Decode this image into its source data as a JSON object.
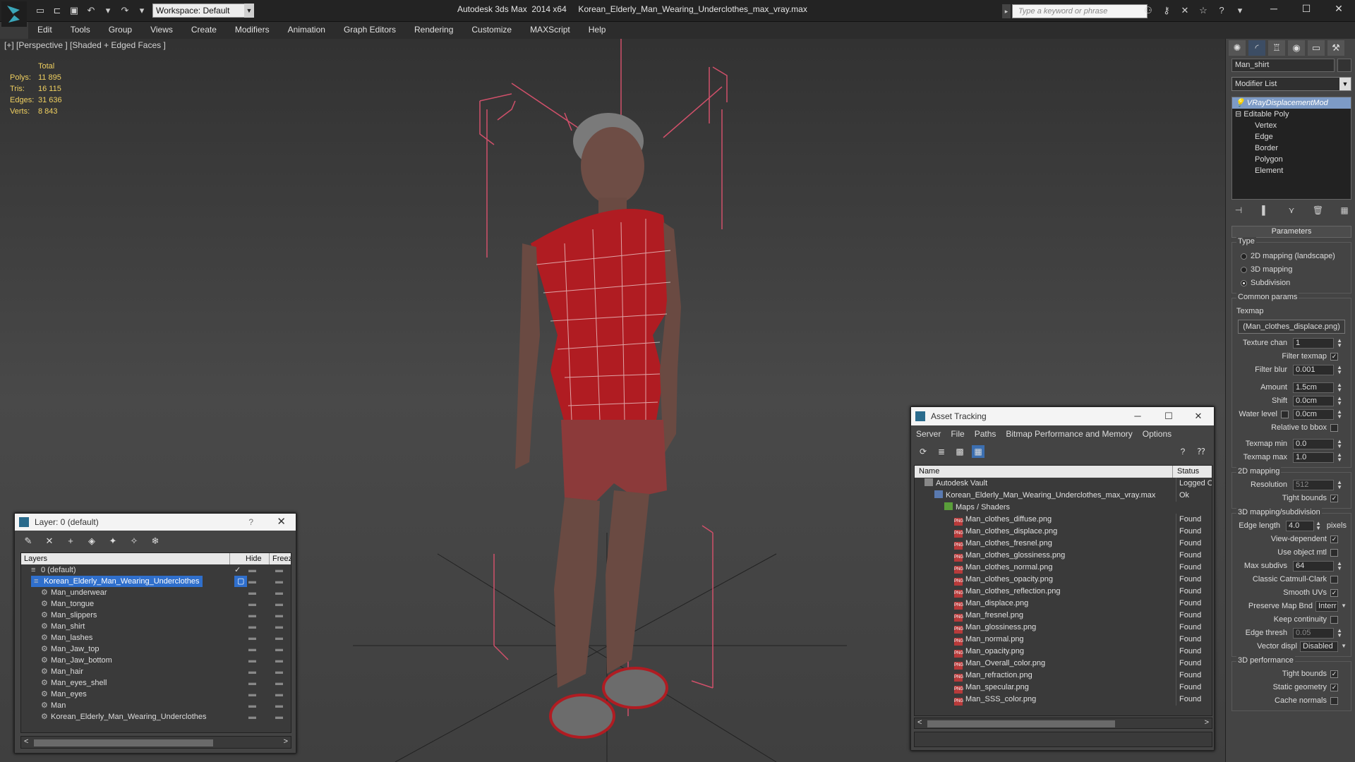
{
  "app": {
    "title": "Autodesk 3ds Max  2014 x64     Korean_Elderly_Man_Wearing_Underclothes_max_vray.max",
    "workspace": "Workspace: Default",
    "search_placeholder": "Type a keyword or phrase"
  },
  "menu": [
    "Edit",
    "Tools",
    "Group",
    "Views",
    "Create",
    "Modifiers",
    "Animation",
    "Graph Editors",
    "Rendering",
    "Customize",
    "MAXScript",
    "Help"
  ],
  "viewport": {
    "label": "[+] [Perspective ] [Shaded + Edged Faces ]",
    "stats_header": "Total",
    "stats": [
      {
        "label": "Polys:",
        "value": "11 895"
      },
      {
        "label": "Tris:",
        "value": "16 115"
      },
      {
        "label": "Edges:",
        "value": "31 636"
      },
      {
        "label": "Verts:",
        "value": "8 843"
      }
    ]
  },
  "command_panel": {
    "object_name": "Man_shirt",
    "modifier_list": "Modifier List",
    "stack": [
      {
        "label": "VRayDisplacementMod",
        "level": 0,
        "selected": true
      },
      {
        "label": "Editable Poly",
        "level": 0,
        "selected": false
      },
      {
        "label": "Vertex",
        "level": 1,
        "selected": false
      },
      {
        "label": "Edge",
        "level": 1,
        "selected": false
      },
      {
        "label": "Border",
        "level": 1,
        "selected": false
      },
      {
        "label": "Polygon",
        "level": 1,
        "selected": false
      },
      {
        "label": "Element",
        "level": 1,
        "selected": false
      }
    ],
    "parameters_title": "Parameters",
    "type_group": "Type",
    "type_options": [
      {
        "label": "2D mapping (landscape)",
        "on": false
      },
      {
        "label": "3D mapping",
        "on": false
      },
      {
        "label": "Subdivision",
        "on": true
      }
    ],
    "common_group": "Common params",
    "texmap_label": "Texmap",
    "texmap_button": "(Man_clothes_displace.png)",
    "texture_chan_label": "Texture chan",
    "texture_chan": "1",
    "filter_texmap_label": "Filter texmap",
    "filter_blur_label": "Filter blur",
    "filter_blur": "0.001",
    "amount_label": "Amount",
    "amount": "1.5cm",
    "shift_label": "Shift",
    "shift": "0.0cm",
    "water_label": "Water level",
    "water": "0.0cm",
    "relative_bbox_label": "Relative to bbox",
    "texmap_min_label": "Texmap min",
    "texmap_min": "0.0",
    "texmap_max_label": "Texmap max",
    "texmap_max": "1.0",
    "map2d_group": "2D mapping",
    "resolution_label": "Resolution",
    "resolution": "512",
    "tight_bounds_label": "Tight bounds",
    "map3d_group": "3D mapping/subdivision",
    "edge_length_label": "Edge length",
    "edge_length": "4.0",
    "pixels_label": "pixels",
    "view_dependent_label": "View-dependent",
    "use_object_mtl_label": "Use object mtl",
    "max_subdivs_label": "Max subdivs",
    "max_subdivs": "64",
    "catmull_label": "Classic Catmull-Clark",
    "smooth_uvs_label": "Smooth UVs",
    "preserve_label": "Preserve Map Bnd",
    "preserve_value": "Interr",
    "keep_continuity_label": "Keep continuity",
    "edge_thresh_label": "Edge thresh",
    "edge_thresh": "0.05",
    "vector_label": "Vector displ",
    "vector_value": "Disabled",
    "perf_group": "3D performance",
    "perf_tight_label": "Tight bounds",
    "static_geom_label": "Static geometry",
    "cache_normals_label": "Cache normals"
  },
  "layer_window": {
    "title": "Layer: 0 (default)",
    "help": "?",
    "columns": [
      "Layers",
      "Hide",
      "Freez"
    ],
    "rows": [
      {
        "name": "0 (default)",
        "indent": 1,
        "selected": false
      },
      {
        "name": "Korean_Elderly_Man_Wearing_Underclothes",
        "indent": 1,
        "selected": true
      },
      {
        "name": "Man_underwear",
        "indent": 2,
        "selected": false
      },
      {
        "name": "Man_tongue",
        "indent": 2,
        "selected": false
      },
      {
        "name": "Man_slippers",
        "indent": 2,
        "selected": false
      },
      {
        "name": "Man_shirt",
        "indent": 2,
        "selected": false
      },
      {
        "name": "Man_lashes",
        "indent": 2,
        "selected": false
      },
      {
        "name": "Man_Jaw_top",
        "indent": 2,
        "selected": false
      },
      {
        "name": "Man_Jaw_bottom",
        "indent": 2,
        "selected": false
      },
      {
        "name": "Man_hair",
        "indent": 2,
        "selected": false
      },
      {
        "name": "Man_eyes_shell",
        "indent": 2,
        "selected": false
      },
      {
        "name": "Man_eyes",
        "indent": 2,
        "selected": false
      },
      {
        "name": "Man",
        "indent": 2,
        "selected": false
      },
      {
        "name": "Korean_Elderly_Man_Wearing_Underclothes",
        "indent": 2,
        "selected": false
      }
    ]
  },
  "asset_window": {
    "title": "Asset Tracking",
    "menu": [
      "Server",
      "File",
      "Paths",
      "Bitmap Performance and Memory",
      "Options"
    ],
    "columns": [
      "Name",
      "Status"
    ],
    "rows": [
      {
        "name": "Autodesk Vault",
        "status": "Logged O",
        "indent": 1,
        "kind": "vault"
      },
      {
        "name": "Korean_Elderly_Man_Wearing_Underclothes_max_vray.max",
        "status": "Ok",
        "indent": 2,
        "kind": "max"
      },
      {
        "name": "Maps / Shaders",
        "status": "",
        "indent": 3,
        "kind": "folder"
      },
      {
        "name": "Man_clothes_diffuse.png",
        "status": "Found",
        "indent": 4,
        "kind": "png"
      },
      {
        "name": "Man_clothes_displace.png",
        "status": "Found",
        "indent": 4,
        "kind": "png"
      },
      {
        "name": "Man_clothes_fresnel.png",
        "status": "Found",
        "indent": 4,
        "kind": "png"
      },
      {
        "name": "Man_clothes_glossiness.png",
        "status": "Found",
        "indent": 4,
        "kind": "png"
      },
      {
        "name": "Man_clothes_normal.png",
        "status": "Found",
        "indent": 4,
        "kind": "png"
      },
      {
        "name": "Man_clothes_opacity.png",
        "status": "Found",
        "indent": 4,
        "kind": "png"
      },
      {
        "name": "Man_clothes_reflection.png",
        "status": "Found",
        "indent": 4,
        "kind": "png"
      },
      {
        "name": "Man_displace.png",
        "status": "Found",
        "indent": 4,
        "kind": "png"
      },
      {
        "name": "Man_fresnel.png",
        "status": "Found",
        "indent": 4,
        "kind": "png"
      },
      {
        "name": "Man_glossiness.png",
        "status": "Found",
        "indent": 4,
        "kind": "png"
      },
      {
        "name": "Man_normal.png",
        "status": "Found",
        "indent": 4,
        "kind": "png"
      },
      {
        "name": "Man_opacity.png",
        "status": "Found",
        "indent": 4,
        "kind": "png"
      },
      {
        "name": "Man_Overall_color.png",
        "status": "Found",
        "indent": 4,
        "kind": "png"
      },
      {
        "name": "Man_refraction.png",
        "status": "Found",
        "indent": 4,
        "kind": "png"
      },
      {
        "name": "Man_specular.png",
        "status": "Found",
        "indent": 4,
        "kind": "png"
      },
      {
        "name": "Man_SSS_color.png",
        "status": "Found",
        "indent": 4,
        "kind": "png"
      }
    ]
  },
  "colors": {
    "accent": "#2f6fcc",
    "stat_text": "#f0d060",
    "bbox": "#d0506a",
    "shirt": "#b01c22"
  }
}
